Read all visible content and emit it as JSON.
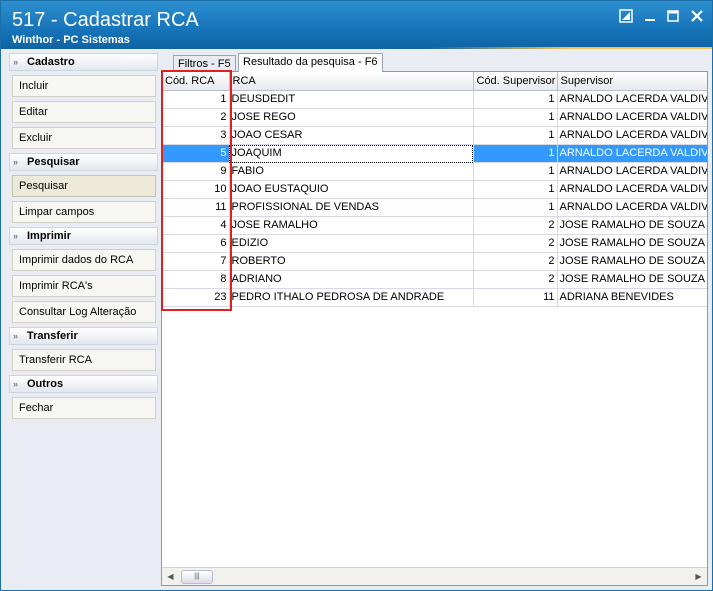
{
  "window": {
    "title": "517 - Cadastrar RCA",
    "subtitle": "Winthor - PC Sistemas",
    "controls": [
      "restore",
      "minimize",
      "maximize",
      "close"
    ]
  },
  "sidebar": {
    "sections": [
      {
        "label": "Cadastro",
        "items": [
          "Incluir",
          "Editar",
          "Excluir"
        ]
      },
      {
        "label": "Pesquisar",
        "items": [
          "Pesquisar",
          "Limpar campos"
        ]
      },
      {
        "label": "Imprimir",
        "items": [
          "Imprimir dados do RCA",
          "Imprimir RCA's",
          "Consultar Log Alteração"
        ]
      },
      {
        "label": "Transferir",
        "items": [
          "Transferir RCA"
        ]
      },
      {
        "label": "Outros",
        "items": [
          "Fechar"
        ]
      }
    ],
    "selected_item": "Pesquisar"
  },
  "tabs": [
    {
      "label": "Filtros - F5"
    },
    {
      "label": "Resultado da pesquisa - F6"
    }
  ],
  "active_tab": "Resultado da pesquisa - F6",
  "grid": {
    "columns": [
      "Cód. RCA",
      "RCA",
      "Cód. Supervisor",
      "Supervisor"
    ],
    "selected_row_index": 3,
    "rows": [
      [
        "1",
        "DEUSDEDIT",
        "1",
        "ARNALDO LACERDA VALDIVINO"
      ],
      [
        "2",
        "JOSE REGO",
        "1",
        "ARNALDO LACERDA VALDIVINO"
      ],
      [
        "3",
        "JOAO CESAR",
        "1",
        "ARNALDO LACERDA VALDIVINO"
      ],
      [
        "5",
        "JOAQUIM",
        "1",
        "ARNALDO LACERDA VALDIVINO"
      ],
      [
        "9",
        "FABIO",
        "1",
        "ARNALDO LACERDA VALDIVINO"
      ],
      [
        "10",
        "JOAO EUSTAQUIO",
        "1",
        "ARNALDO LACERDA VALDIVINO"
      ],
      [
        "11",
        "PROFISSIONAL DE VENDAS",
        "1",
        "ARNALDO LACERDA VALDIVINO"
      ],
      [
        "4",
        "JOSE RAMALHO",
        "2",
        "JOSE RAMALHO DE SOUZA"
      ],
      [
        "6",
        "EDIZIO",
        "2",
        "JOSE RAMALHO DE SOUZA"
      ],
      [
        "7",
        "ROBERTO",
        "2",
        "JOSE RAMALHO DE SOUZA"
      ],
      [
        "8",
        "ADRIANO",
        "2",
        "JOSE RAMALHO DE SOUZA"
      ],
      [
        "23",
        "PEDRO ITHALO PEDROSA DE ANDRADE",
        "11",
        "ADRIANA BENEVIDES"
      ]
    ]
  },
  "colors": {
    "titlebar": "#1674b8",
    "selection": "#3399ff",
    "highlight_box": "#e02020"
  }
}
